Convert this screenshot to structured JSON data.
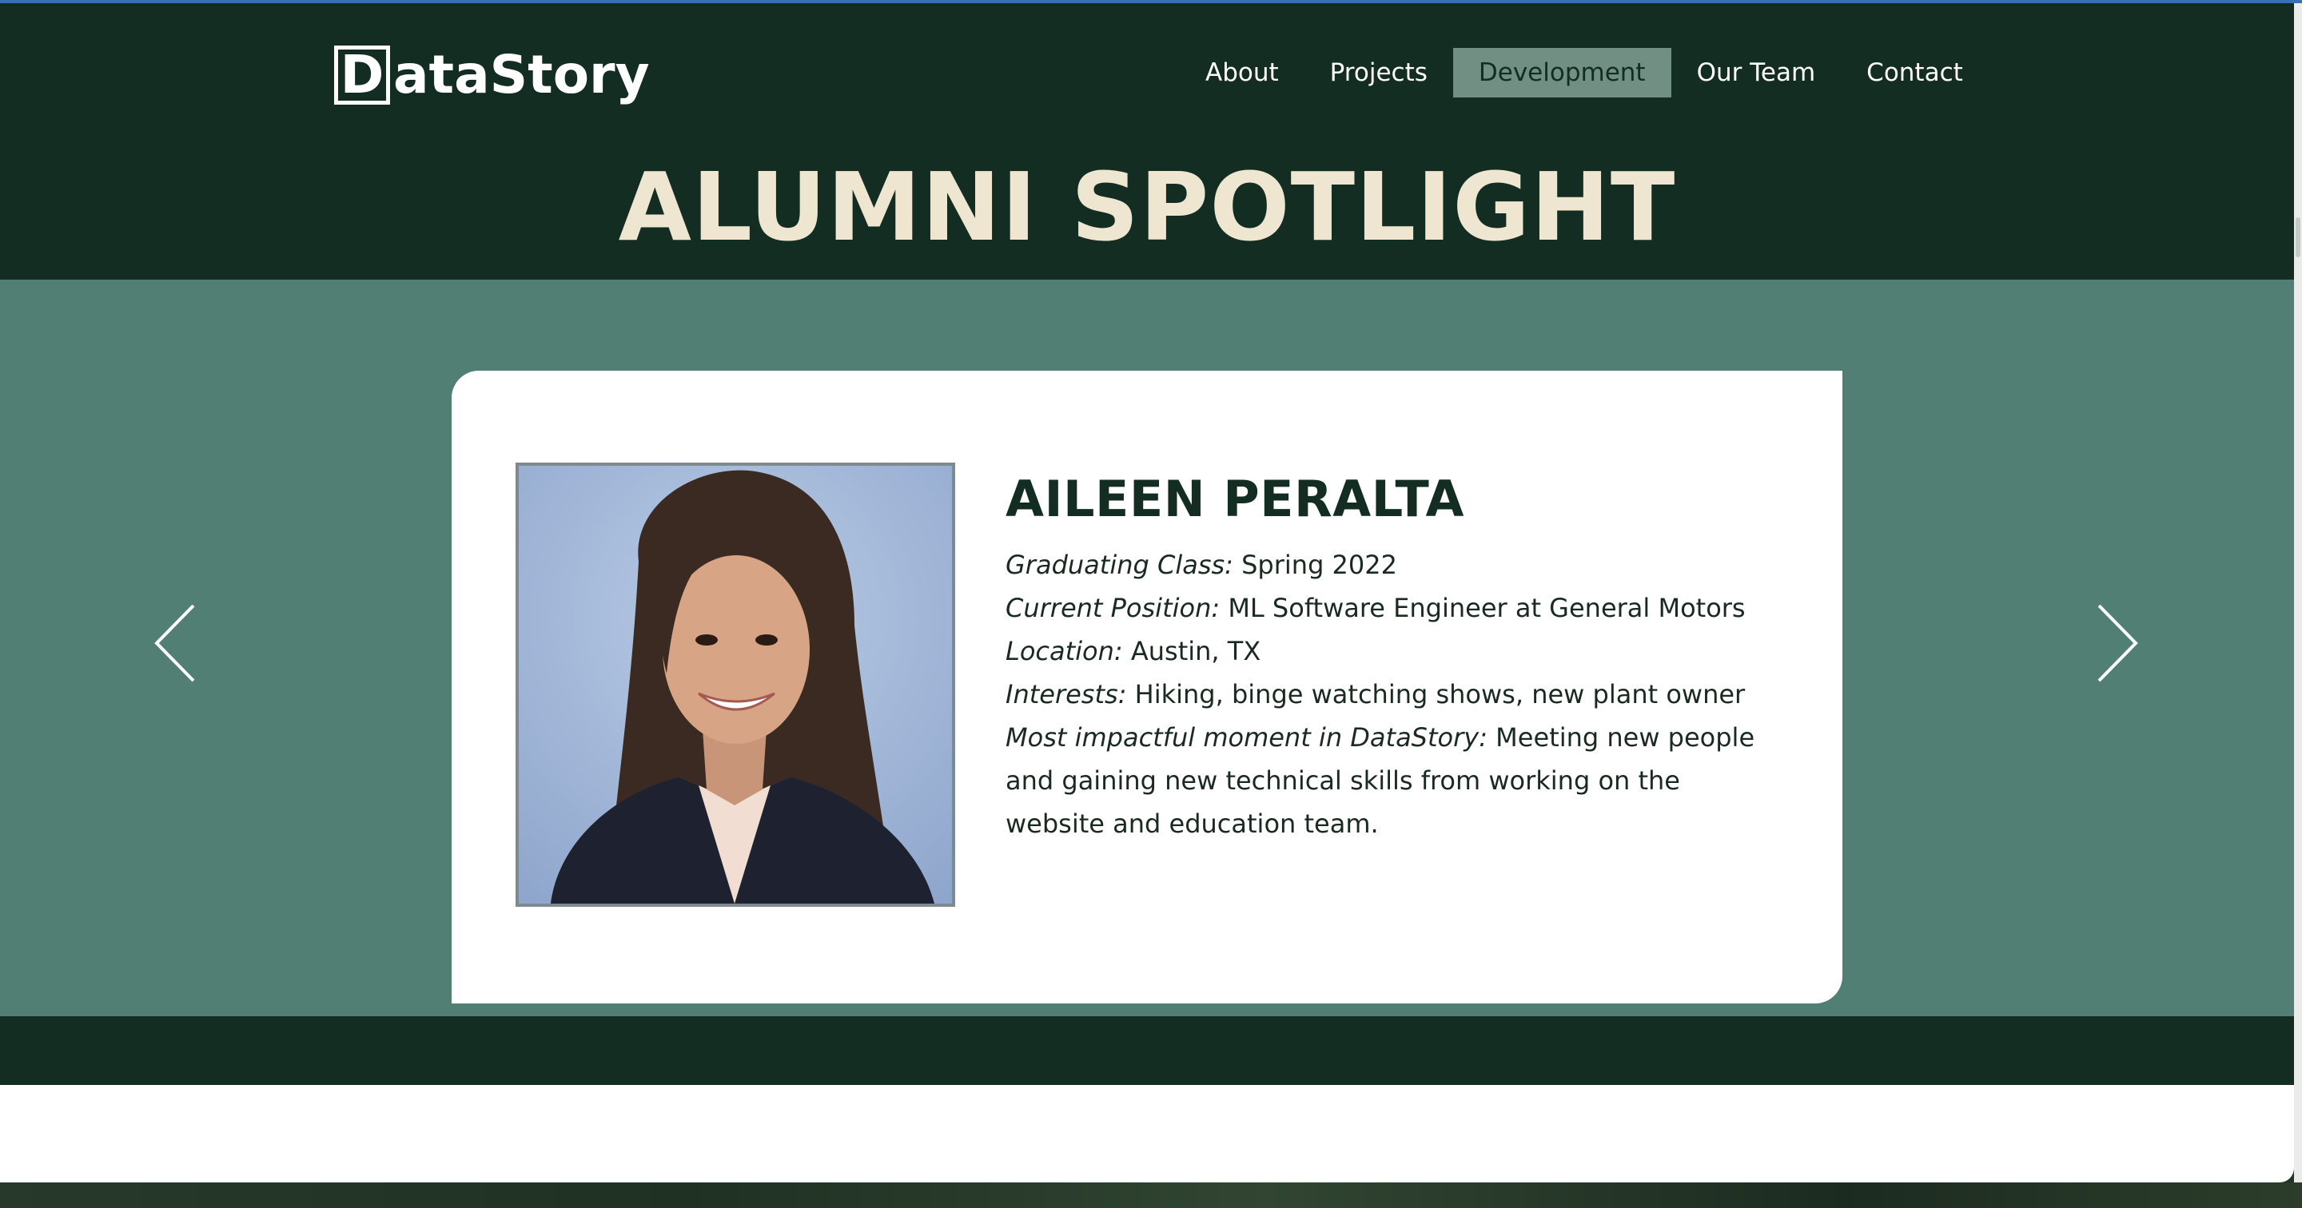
{
  "logo": {
    "box_letter": "D",
    "rest": "ataStory"
  },
  "nav": {
    "items": [
      {
        "label": "About",
        "active": false
      },
      {
        "label": "Projects",
        "active": false
      },
      {
        "label": "Development",
        "active": true
      },
      {
        "label": "Our Team",
        "active": false
      },
      {
        "label": "Contact",
        "active": false
      }
    ]
  },
  "page_title": "ALUMNI SPOTLIGHT",
  "carousel": {
    "prev_icon": "chevron-left-icon",
    "next_icon": "chevron-right-icon",
    "profile": {
      "name": "AILEEN PERALTA",
      "fields": [
        {
          "label": "Graduating Class:",
          "value": "Spring 2022"
        },
        {
          "label": "Current Position:",
          "value": "ML Software Engineer at General Motors"
        },
        {
          "label": "Location:",
          "value": "Austin, TX"
        },
        {
          "label": "Interests:",
          "value": "Hiking, binge watching shows, new plant owner"
        },
        {
          "label": "Most impactful moment in DataStory:",
          "value": "Meeting new people and gaining new technical skills from working on the website and education team."
        }
      ]
    }
  },
  "colors": {
    "header_bg": "#132d22",
    "band_bg": "#527f73",
    "title_color": "#efe6d2",
    "active_nav_bg": "#728f84"
  }
}
